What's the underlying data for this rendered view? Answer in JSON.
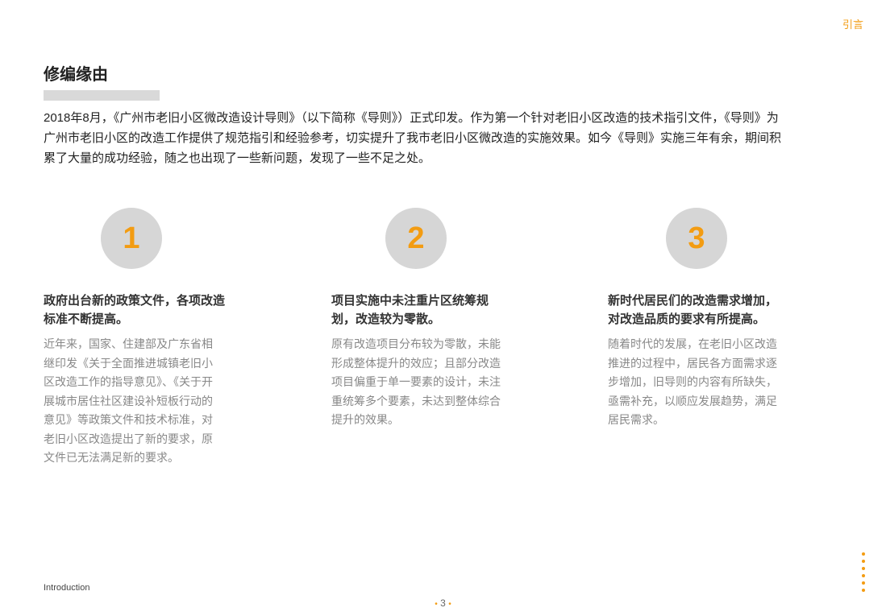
{
  "header": {
    "section_tag": "引言"
  },
  "main": {
    "title": "修编缘由",
    "intro": "2018年8月，《广州市老旧小区微改造设计导则》（以下简称《导则》）正式印发。作为第一个针对老旧小区改造的技术指引文件，《导则》为广州市老旧小区的改造工作提供了规范指引和经验参考，切实提升了我市老旧小区微改造的实施效果。如今《导则》实施三年有余，期间积累了大量的成功经验，随之也出现了一些新问题，发现了一些不足之处。",
    "cards": [
      {
        "number": "1",
        "heading": "政府出台新的政策文件，各项改造标准不断提高。",
        "body": "近年来，国家、住建部及广东省相继印发《关于全面推进城镇老旧小区改造工作的指导意见》、《关于开展城市居住社区建设补短板行动的意见》等政策文件和技术标准，对老旧小区改造提出了新的要求，原文件已无法满足新的要求。"
      },
      {
        "number": "2",
        "heading": "项目实施中未注重片区统筹规划，改造较为零散。",
        "body": "原有改造项目分布较为零散，未能形成整体提升的效应；且部分改造项目偏重于单一要素的设计，未注重统筹多个要素，未达到整体综合提升的效果。"
      },
      {
        "number": "3",
        "heading": "新时代居民们的改造需求增加，对改造品质的要求有所提高。",
        "body": "随着时代的发展，在老旧小区改造推进的过程中，居民各方面需求逐步增加，旧导则的内容有所缺失，亟需补充，以顺应发展趋势，满足居民需求。"
      }
    ]
  },
  "footer": {
    "label": "Introduction",
    "page_number": "3"
  },
  "colors": {
    "accent": "#f39c12",
    "circle": "#d6d6d6",
    "underline": "#d9d9d9",
    "body_text": "#888888"
  }
}
